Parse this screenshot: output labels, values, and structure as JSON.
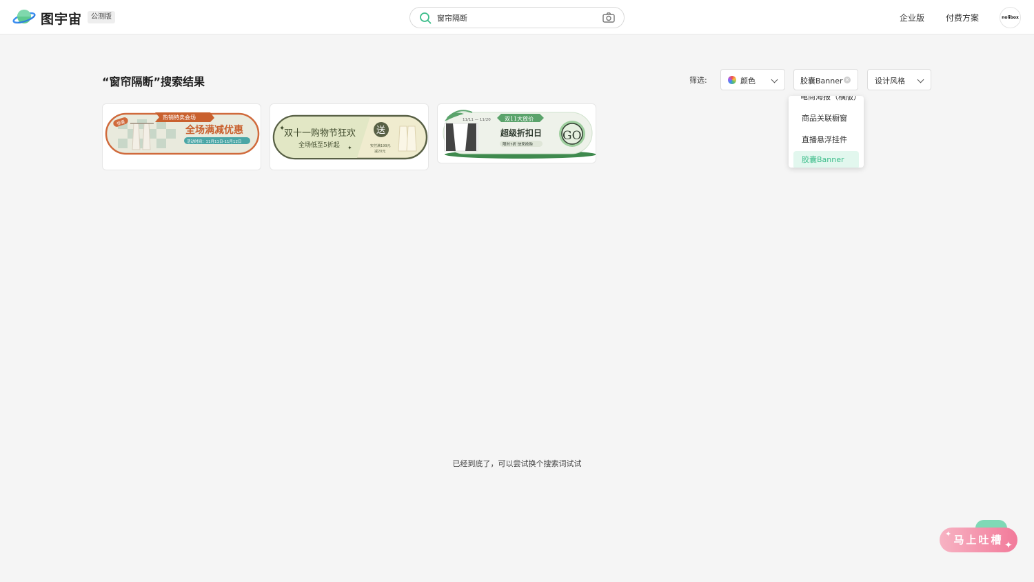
{
  "header": {
    "brand": "图宇宙",
    "badge": "公测版",
    "search_value": "窗帘隔断",
    "nav": [
      "企业版",
      "付费方案"
    ],
    "avatar_text": "nolibox"
  },
  "results": {
    "title": "“窗帘隔断”搜索结果",
    "filter_label": "筛选:",
    "filters": {
      "color": "颜色",
      "category": "胶囊Banner",
      "style": "设计风格"
    },
    "dropdown_items": [
      "电商海报（横版）",
      "商品关联橱窗",
      "直播悬浮挂件",
      "胶囊Banner"
    ],
    "selected_item": "胶囊Banner"
  },
  "cards": [
    {
      "tag": "惊喜",
      "top_label": "热销特卖会场",
      "headline": "全场满减优惠",
      "sub": "活动时间：11月11日-11月12日",
      "colors": {
        "border": "#d06a3c",
        "accent": "#c9602e",
        "bg": "#e9eadd"
      }
    },
    {
      "headline": "双十一购物节狂欢",
      "sub": "全场低至5折起",
      "badge": "送",
      "side_line1": "实付满199元",
      "side_line2": "减20元",
      "colors": {
        "border": "#586045",
        "bg": "#f0eccf"
      }
    },
    {
      "date": "11/11 — 11/20",
      "top_label": "双11大放价",
      "headline": "超级折扣日",
      "sub": "限时7折 快来抢购",
      "badge": "GO",
      "colors": {
        "green": "#5aa36b",
        "bg": "#eef2ea"
      }
    }
  ],
  "footer_text": "已经到底了，可以尝试换个搜索词试试",
  "feedback_label": "马上吐槽"
}
